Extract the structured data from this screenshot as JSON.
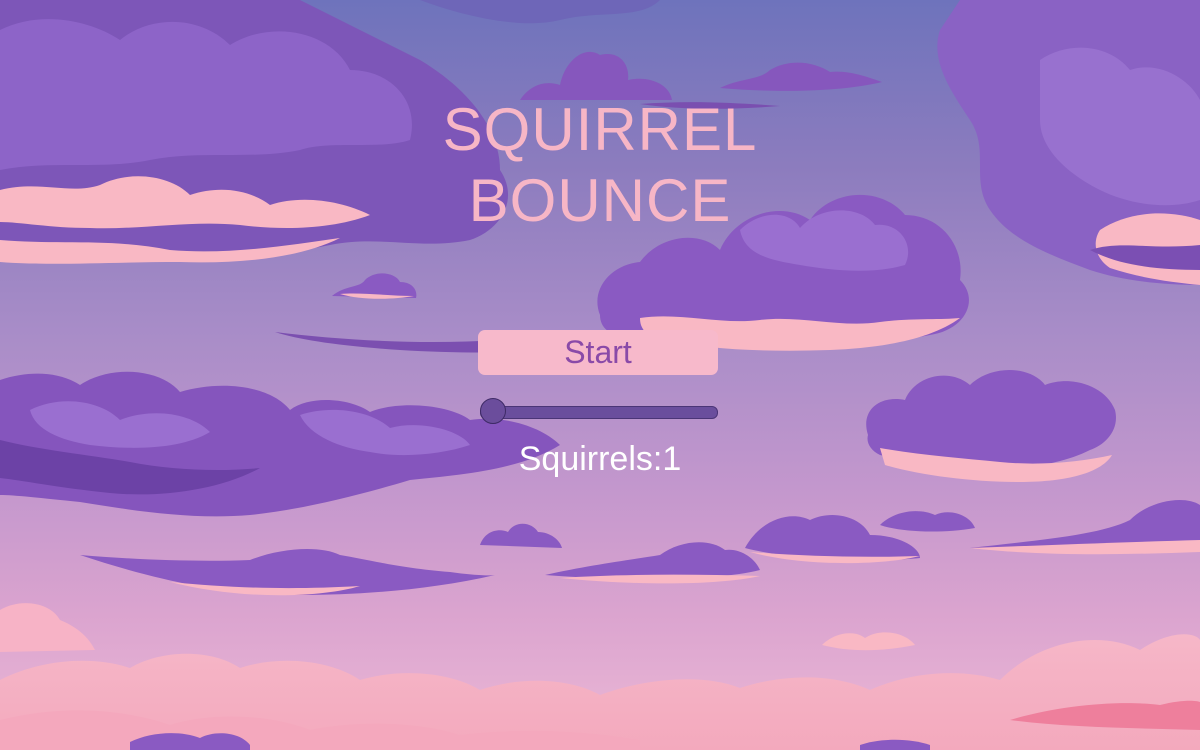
{
  "game": {
    "title_line_1": "SQUIRREL",
    "title_line_2": "BOUNCE",
    "start_label": "Start",
    "squirrel_count_label": "Squirrels:",
    "squirrel_count": 1,
    "slider_fraction": 0
  },
  "colors": {
    "title": "#f7b6c6",
    "button_bg": "#f7b9cb",
    "button_text": "#8a4aa8",
    "slider_track": "#6a4e9d",
    "cloud_purple": "#8f5cc2",
    "cloud_pink": "#f9b8c4"
  }
}
